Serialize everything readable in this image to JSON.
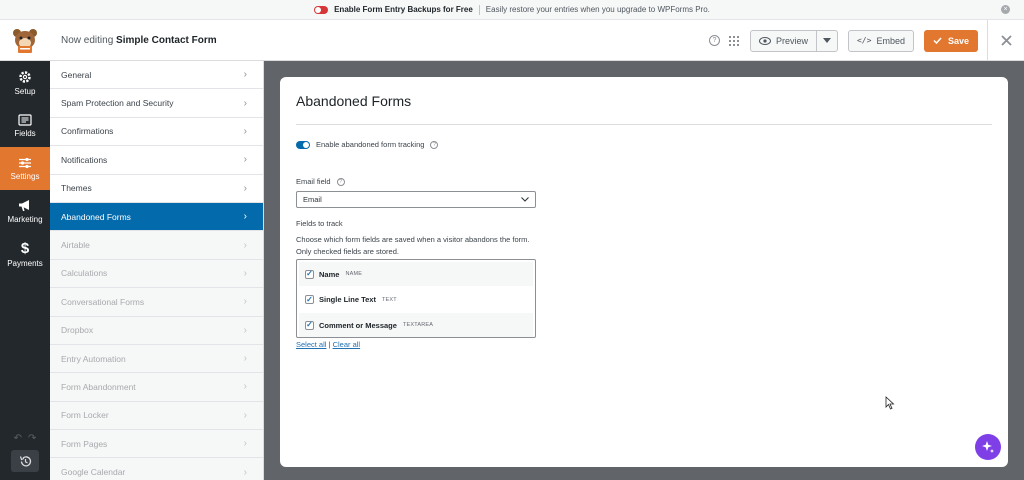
{
  "notice": {
    "title": "Enable Form Entry Backups for Free",
    "text": "Easily restore your entries when you upgrade to WPForms Pro."
  },
  "header": {
    "editing_prefix": "Now editing",
    "form_name": "Simple Contact Form",
    "help_icon": "question-icon",
    "preview_label": "Preview",
    "embed_label": "Embed",
    "save_label": "Save"
  },
  "rail": {
    "items": [
      {
        "label": "Setup",
        "icon": "gear-icon"
      },
      {
        "label": "Fields",
        "icon": "fields-icon"
      },
      {
        "label": "Settings",
        "icon": "sliders-icon"
      },
      {
        "label": "Marketing",
        "icon": "megaphone-icon"
      },
      {
        "label": "Payments",
        "icon": "dollar-icon"
      }
    ]
  },
  "settings_nav": {
    "items": [
      {
        "label": "General"
      },
      {
        "label": "Spam Protection and Security"
      },
      {
        "label": "Confirmations"
      },
      {
        "label": "Notifications"
      },
      {
        "label": "Themes"
      },
      {
        "label": "Abandoned Forms"
      },
      {
        "label": "Airtable"
      },
      {
        "label": "Calculations"
      },
      {
        "label": "Conversational Forms"
      },
      {
        "label": "Dropbox"
      },
      {
        "label": "Entry Automation"
      },
      {
        "label": "Form Abandonment"
      },
      {
        "label": "Form Locker"
      },
      {
        "label": "Form Pages"
      },
      {
        "label": "Google Calendar"
      }
    ]
  },
  "panel": {
    "title": "Abandoned Forms",
    "toggle_label": "Enable abandoned form tracking",
    "email_label": "Email field",
    "email_value": "Email",
    "fields_label": "Fields to track",
    "desc_line1": "Choose which form fields are saved when a visitor abandons the form.",
    "desc_line2": "Only checked fields are stored.",
    "fields": [
      {
        "name": "Name",
        "type": "NAME"
      },
      {
        "name": "Single Line Text",
        "type": "TEXT"
      },
      {
        "name": "Comment or Message",
        "type": "TEXTAREA"
      }
    ],
    "select_all": "Select all",
    "separator": "|",
    "clear_all": "Clear all"
  },
  "colors": {
    "accent": "#e27730",
    "active_nav": "#036aab",
    "rail_bg": "#23282c",
    "ai_button": "#7f3fe6"
  }
}
